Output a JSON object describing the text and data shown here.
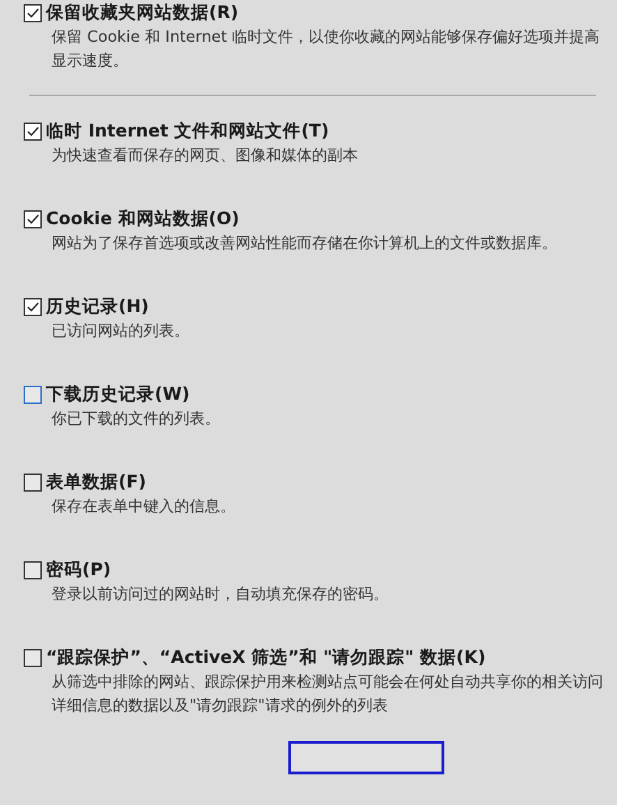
{
  "favorites_option": {
    "label": "保留收藏夹网站数据(R)",
    "description": "保留 Cookie 和 Internet 临时文件，以使你收藏的网站能够保存偏好选项并提高显示速度。",
    "checked": true
  },
  "options": [
    {
      "label": "临时 Internet 文件和网站文件(T)",
      "description": "为快速查看而保存的网页、图像和媒体的副本",
      "checked": true
    },
    {
      "label": "Cookie 和网站数据(O)",
      "description": "网站为了保存首选项或改善网站性能而存储在你计算机上的文件或数据库。",
      "checked": true
    },
    {
      "label": "历史记录(H)",
      "description": "已访问网站的列表。",
      "checked": true
    },
    {
      "label": "下载历史记录(W)",
      "description": "你已下载的文件的列表。",
      "checked": false
    },
    {
      "label": "表单数据(F)",
      "description": "保存在表单中键入的信息。",
      "checked": false
    },
    {
      "label": "密码(P)",
      "description": "登录以前访问过的网站时，自动填充保存的密码。",
      "checked": false
    },
    {
      "label": "“跟踪保护”、“ActiveX 筛选”和 \"请勿跟踪\" 数据(K)",
      "description": "从筛选中排除的网站、跟踪保护用来检测站点可能会在何处自动共享你的相关访问详细信息的数据以及\"请勿跟踪\"请求的例外的列表",
      "checked": false
    }
  ]
}
